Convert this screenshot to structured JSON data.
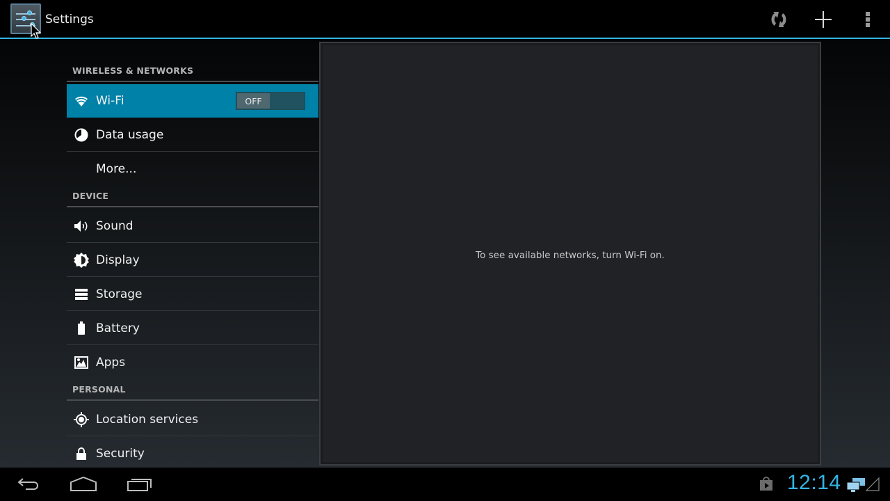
{
  "action_bar": {
    "title": "Settings",
    "app_icon": "settings-sliders-icon",
    "actions": [
      {
        "name": "sync-icon",
        "label": "Sync"
      },
      {
        "name": "add-icon",
        "label": "Add network"
      },
      {
        "name": "overflow-menu-icon",
        "label": "More options"
      }
    ],
    "accent_color": "#33b5e5"
  },
  "settings_list": {
    "sections": [
      {
        "header": "WIRELESS & NETWORKS",
        "items": [
          {
            "label": "Wi-Fi",
            "icon": "wifi-icon",
            "selected": true,
            "toggle": "OFF"
          },
          {
            "label": "Data usage",
            "icon": "data-usage-icon"
          },
          {
            "label": "More...",
            "icon": ""
          }
        ]
      },
      {
        "header": "DEVICE",
        "items": [
          {
            "label": "Sound",
            "icon": "sound-icon"
          },
          {
            "label": "Display",
            "icon": "display-brightness-icon"
          },
          {
            "label": "Storage",
            "icon": "storage-icon"
          },
          {
            "label": "Battery",
            "icon": "battery-icon"
          },
          {
            "label": "Apps",
            "icon": "apps-icon"
          }
        ]
      },
      {
        "header": "PERSONAL",
        "items": [
          {
            "label": "Location services",
            "icon": "location-icon"
          },
          {
            "label": "Security",
            "icon": "lock-icon"
          }
        ]
      }
    ],
    "selected_color": "#0081a7"
  },
  "detail": {
    "message": "To see available networks, turn Wi-Fi on."
  },
  "nav_bar": {
    "buttons": [
      "back-icon",
      "home-icon",
      "recent-apps-icon"
    ],
    "clock": "12:14",
    "status_icons": [
      "play-store-icon",
      "network-computers-icon",
      "signal-icon"
    ]
  }
}
